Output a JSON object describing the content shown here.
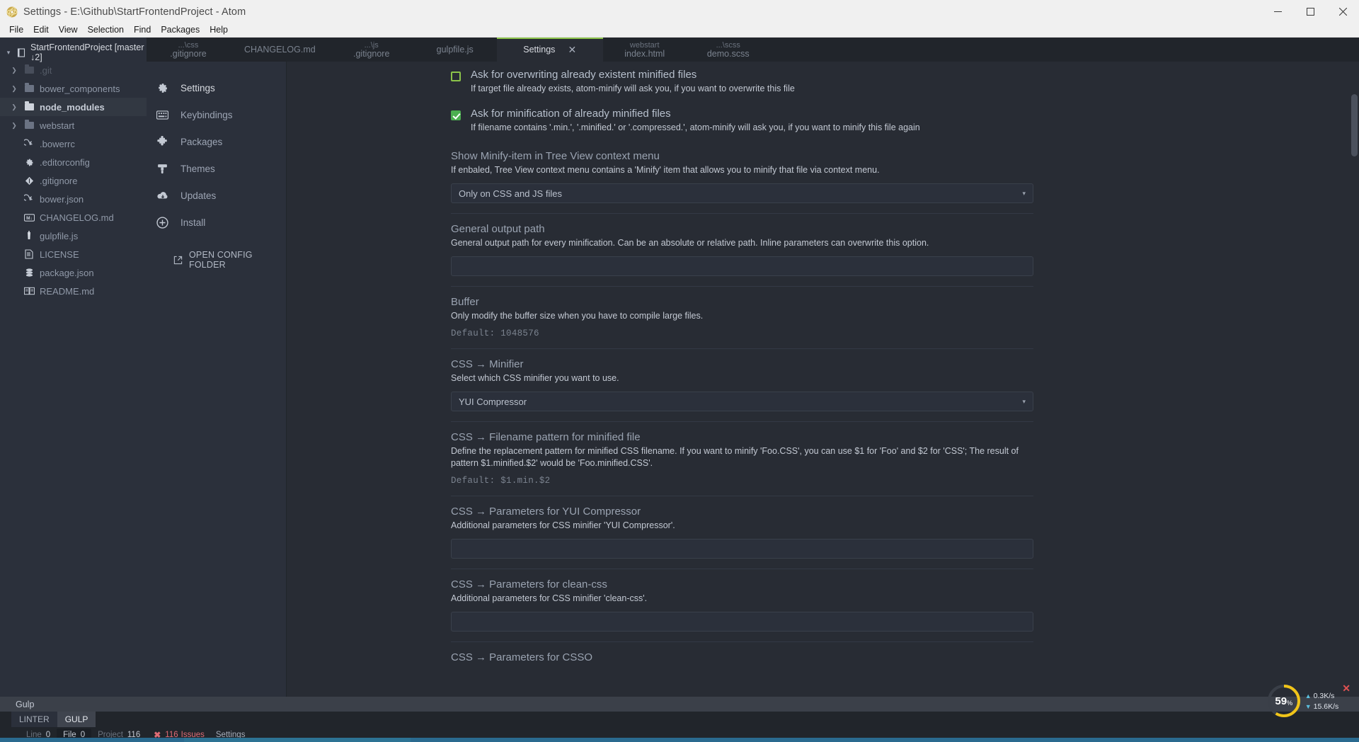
{
  "titlebar": {
    "title": "Settings - E:\\Github\\StartFrontendProject - Atom",
    "minimize": "–",
    "maximize": "❐",
    "close": "✕"
  },
  "menubar": {
    "items": [
      "File",
      "Edit",
      "View",
      "Selection",
      "Find",
      "Packages",
      "Help"
    ]
  },
  "tree": {
    "root": "StartFrontendProject [master ↓2]",
    "items": [
      {
        "label": ".git",
        "type": "folder",
        "state": "dim",
        "icon": "folder-icon"
      },
      {
        "label": "bower_components",
        "type": "folder",
        "state": "normal",
        "icon": "folder-icon"
      },
      {
        "label": "node_modules",
        "type": "folder",
        "state": "bold",
        "icon": "folder-open-icon"
      },
      {
        "label": "webstart",
        "type": "folder",
        "state": "normal",
        "icon": "folder-icon"
      },
      {
        "label": ".bowerrc",
        "type": "file",
        "state": "normal",
        "icon": "bower-icon"
      },
      {
        "label": ".editorconfig",
        "type": "file",
        "state": "normal",
        "icon": "gear-icon"
      },
      {
        "label": ".gitignore",
        "type": "file",
        "state": "normal",
        "icon": "git-icon"
      },
      {
        "label": "bower.json",
        "type": "file",
        "state": "normal",
        "icon": "bower-icon"
      },
      {
        "label": "CHANGELOG.md",
        "type": "file",
        "state": "normal",
        "icon": "markdown-icon"
      },
      {
        "label": "gulpfile.js",
        "type": "file",
        "state": "normal",
        "icon": "gulp-icon"
      },
      {
        "label": "LICENSE",
        "type": "file",
        "state": "normal",
        "icon": "document-icon"
      },
      {
        "label": "package.json",
        "type": "file",
        "state": "normal",
        "icon": "npm-icon"
      },
      {
        "label": "README.md",
        "type": "file",
        "state": "normal",
        "icon": "book-icon"
      }
    ]
  },
  "tabs": [
    {
      "sub": "...\\css",
      "name": ".gitignore",
      "active": false
    },
    {
      "sub": "",
      "name": "CHANGELOG.md",
      "active": false
    },
    {
      "sub": "...\\js",
      "name": ".gitignore",
      "active": false
    },
    {
      "sub": "",
      "name": "gulpfile.js",
      "active": false
    },
    {
      "sub": "",
      "name": "Settings",
      "active": true,
      "close": "✕"
    },
    {
      "sub": "webstart",
      "name": "index.html",
      "active": false
    },
    {
      "sub": "...\\scss",
      "name": "demo.scss",
      "active": false
    }
  ],
  "settings_nav": {
    "items": [
      {
        "label": "Settings",
        "icon": "gear-icon",
        "active": true
      },
      {
        "label": "Keybindings",
        "icon": "keyboard-icon",
        "active": false
      },
      {
        "label": "Packages",
        "icon": "puzzle-icon",
        "active": false
      },
      {
        "label": "Themes",
        "icon": "paintbrush-icon",
        "active": false
      },
      {
        "label": "Updates",
        "icon": "cloud-download-icon",
        "active": false
      },
      {
        "label": "Install",
        "icon": "plus-circle-icon",
        "active": false
      }
    ],
    "open_config_folder": "OPEN CONFIG FOLDER",
    "open_config_icon": "external-link-icon"
  },
  "settings_panel": {
    "checkbox_overwrite": {
      "title": "Ask for overwriting already existent minified files",
      "description": "If target file already exists, atom-minify will ask you, if you want to overwrite this file",
      "checked": false
    },
    "checkbox_minify": {
      "title": "Ask for minification of already minified files",
      "description": "If filename contains '.min.', '.minified.' or '.compressed.', atom-minify will ask you, if you want to minify this file again",
      "checked": true
    },
    "tree_view_item": {
      "title": "Show Minify-item in Tree View context menu",
      "description": "If enbaled, Tree View context menu contains a 'Minify' item that allows you to minify that file via context menu.",
      "value": "Only on CSS and JS files",
      "caret": "▾"
    },
    "general_output_path": {
      "title": "General output path",
      "description": "General output path for every minification. Can be an absolute or relative path. Inline parameters can overwrite this option.",
      "value": ""
    },
    "buffer": {
      "title": "Buffer",
      "description": "Only modify the buffer size when you have to compile large files.",
      "default": "Default: 1048576"
    },
    "css_minifier": {
      "title": "CSS → Minifier",
      "description": "Select which CSS minifier you want to use.",
      "value": "YUI Compressor",
      "caret": "▾"
    },
    "css_filename_pattern": {
      "title": "CSS → Filename pattern for minified file",
      "description": "Define the replacement pattern for minified CSS filename. If you want to minify 'Foo.CSS', you can use $1 for 'Foo' and $2 for 'CSS'; The result of pattern $1.minified.$2' would be 'Foo.minified.CSS'.",
      "default": "Default: $1.min.$2"
    },
    "css_params_yui": {
      "title": "CSS → Parameters for YUI Compressor",
      "description": "Additional parameters for CSS minifier 'YUI Compressor'.",
      "value": ""
    },
    "css_params_cleancss": {
      "title": "CSS → Parameters for clean-css",
      "description": "Additional parameters for CSS minifier 'clean-css'.",
      "value": ""
    },
    "css_params_csso": {
      "title": "CSS → Parameters for CSSO"
    }
  },
  "bottom_panel": {
    "gulp_title": "Gulp",
    "tabs": [
      {
        "label": "LINTER",
        "active": false
      },
      {
        "label": "GULP",
        "active": true
      }
    ]
  },
  "statusbar": {
    "line": {
      "key": "Line",
      "value": "0"
    },
    "file": {
      "key": "File",
      "value": "0"
    },
    "project": {
      "key": "Project",
      "value": "116"
    },
    "issues": {
      "icon": "✖",
      "count": "116",
      "label": "Issues"
    },
    "settings": "Settings"
  },
  "network_widget": {
    "percent": "59",
    "percent_symbol": "%",
    "upload": "0.3K/s",
    "download": "15.6K/s",
    "up_arrow": "▲",
    "down_arrow": "▼",
    "close": "✕"
  },
  "colors": {
    "accent_green": "#8bc34a",
    "checked_green": "#4caf50",
    "error_red": "#e06c75",
    "panel_bg": "#282c34",
    "sidebar_bg": "#2b303b",
    "tabbar_bg": "#21252b"
  }
}
